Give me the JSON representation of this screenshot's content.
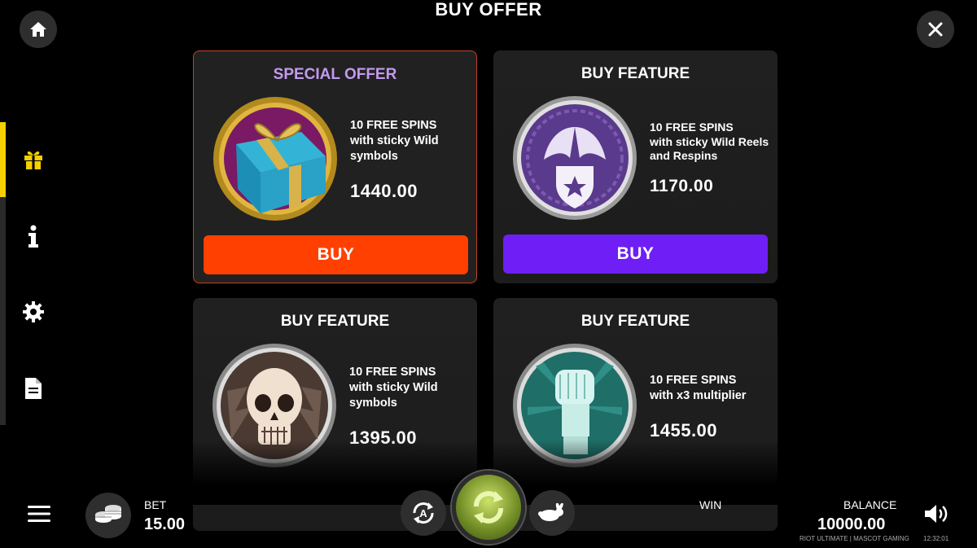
{
  "header": {
    "title": "BUY OFFER"
  },
  "top_buttons": {
    "home_icon": "home-icon",
    "close_icon": "close-icon"
  },
  "sidebar": {
    "active_index": 0,
    "items": [
      {
        "icon": "gift-icon"
      },
      {
        "icon": "info-icon"
      },
      {
        "icon": "gear-icon"
      },
      {
        "icon": "document-icon"
      }
    ]
  },
  "offers": [
    {
      "title": "SPECIAL OFFER",
      "line1": "10 FREE SPINS",
      "line2": "with sticky Wild",
      "line3": "symbols",
      "price": "1440.00",
      "button": "BUY",
      "button_color": "#ff4000",
      "emblem": "gift-box-emblem"
    },
    {
      "title": "BUY FEATURE",
      "line1": "10 FREE SPINS",
      "line2": "with sticky Wild Reels",
      "line3": "and Respins",
      "price": "1170.00",
      "button": "BUY",
      "button_color": "#6f1ff5",
      "emblem": "winged-shield-emblem"
    },
    {
      "title": "BUY FEATURE",
      "line1": "10 FREE SPINS",
      "line2": "with sticky Wild",
      "line3": "symbols",
      "price": "1395.00",
      "emblem": "skull-emblem"
    },
    {
      "title": "BUY FEATURE",
      "line1": "10 FREE SPINS",
      "line2": "with x3 multiplier",
      "price": "1455.00",
      "emblem": "raised-fist-emblem"
    }
  ],
  "bottom": {
    "bet_label": "BET",
    "bet_value": "15.00",
    "win_label": "WIN",
    "balance_label": "BALANCE",
    "balance_value": "10000.00",
    "footer_brand": "RIOT ULTIMATE | MASCOT GAMING",
    "clock": "12:32:01"
  }
}
